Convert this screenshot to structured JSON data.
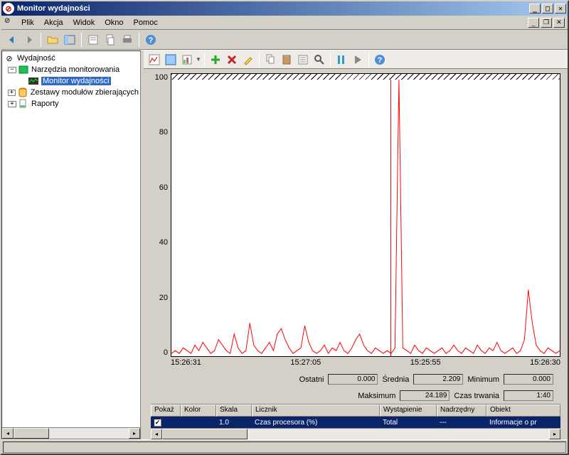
{
  "window": {
    "title": "Monitor wydajności"
  },
  "menu": {
    "file": "Plik",
    "action": "Akcja",
    "view": "Widok",
    "window": "Okno",
    "help": "Pomoc"
  },
  "tree": {
    "root": "Wydajność",
    "tools": "Narzędzia monitorowania",
    "perfmon": "Monitor wydajności",
    "datacollectors": "Zestawy modułów zbierających",
    "reports": "Raporty"
  },
  "xaxis": {
    "t0": "15:26:31",
    "t1": "15:27:05",
    "t2": "15:25:55",
    "t3": "15:26:30"
  },
  "stats": {
    "last_lbl": "Ostatni",
    "last_val": "0.000",
    "avg_lbl": "Średnia",
    "avg_val": "2.209",
    "min_lbl": "Minimum",
    "min_val": "0.000",
    "max_lbl": "Maksimum",
    "max_val": "24.189",
    "dur_lbl": "Czas trwania",
    "dur_val": "1:40"
  },
  "counters": {
    "headers": {
      "show": "Pokaż",
      "color": "Kolor",
      "scale": "Skala",
      "counter": "Licznik",
      "instance": "Wystąpienie",
      "parent": "Nadrzędny",
      "object": "Obiekt"
    },
    "row": {
      "scale": "1.0",
      "counter": "Czas procesora (%)",
      "instance": "Total",
      "parent": "---",
      "object": "Informacje o pr"
    }
  },
  "chart_data": {
    "type": "line",
    "title": "",
    "xlabel": "",
    "ylabel": "",
    "ylim": [
      0,
      100
    ],
    "yticks": [
      0,
      20,
      40,
      60,
      80,
      100
    ],
    "xticks": [
      "15:26:31",
      "15:27:05",
      "15:25:55",
      "15:26:30"
    ],
    "cursor_x_frac": 0.565,
    "series": [
      {
        "name": "Czas procesora (%)",
        "color": "#ff0000",
        "values": [
          1,
          2,
          1,
          3,
          2,
          1,
          4,
          2,
          5,
          3,
          1,
          2,
          6,
          4,
          2,
          1,
          8,
          3,
          1,
          2,
          12,
          4,
          2,
          1,
          3,
          5,
          2,
          8,
          10,
          6,
          3,
          1,
          2,
          3,
          11,
          5,
          2,
          1,
          2,
          4,
          1,
          3,
          2,
          5,
          2,
          1,
          3,
          6,
          8,
          4,
          2,
          1,
          3,
          2,
          1,
          2,
          1,
          3,
          100,
          3,
          2,
          1,
          4,
          2,
          1,
          3,
          2,
          1,
          2,
          3,
          1,
          2,
          4,
          2,
          1,
          3,
          2,
          1,
          4,
          2,
          1,
          3,
          2,
          5,
          2,
          1,
          2,
          3,
          1,
          2,
          6,
          24,
          12,
          4,
          2,
          1,
          3,
          2,
          1,
          2
        ]
      }
    ]
  }
}
